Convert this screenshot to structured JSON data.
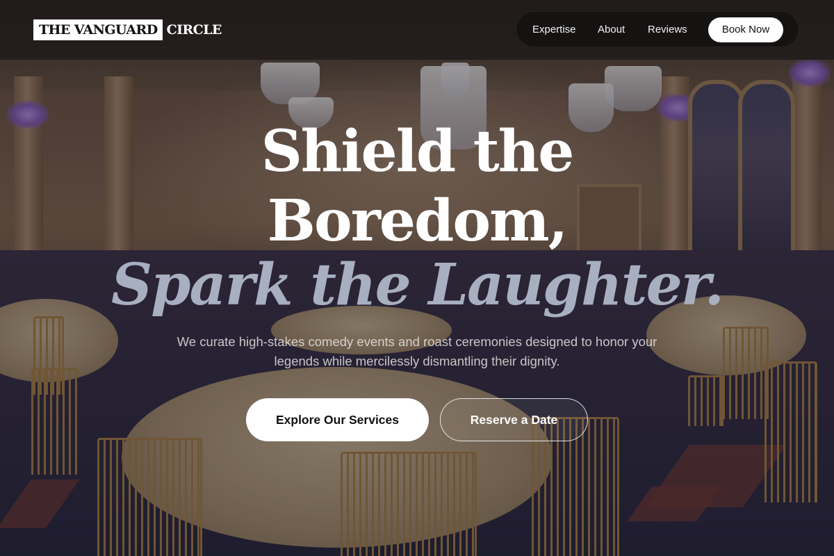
{
  "brand": {
    "logo_box": "THE VANGUARD",
    "logo_rest": "CIRCLE"
  },
  "nav": {
    "items": [
      {
        "label": "Expertise"
      },
      {
        "label": "About"
      },
      {
        "label": "Reviews"
      }
    ],
    "cta_label": "Book Now"
  },
  "hero": {
    "line1": "Shield the",
    "line2": "Boredom,",
    "line3": "Spark the Laughter.",
    "subtitle": "We curate high-stakes comedy events and roast ceremonies designed to honor your legends while mercilessly dismantling their dignity.",
    "primary_cta": "Explore Our Services",
    "secondary_cta": "Reserve a Date"
  },
  "colors": {
    "accent_text": "#a7afc0",
    "header_bg": "#1e1a1a",
    "nav_bg": "#151212",
    "button_bg": "#ffffff"
  },
  "background": {
    "description_icon": "ballroom-photo"
  }
}
